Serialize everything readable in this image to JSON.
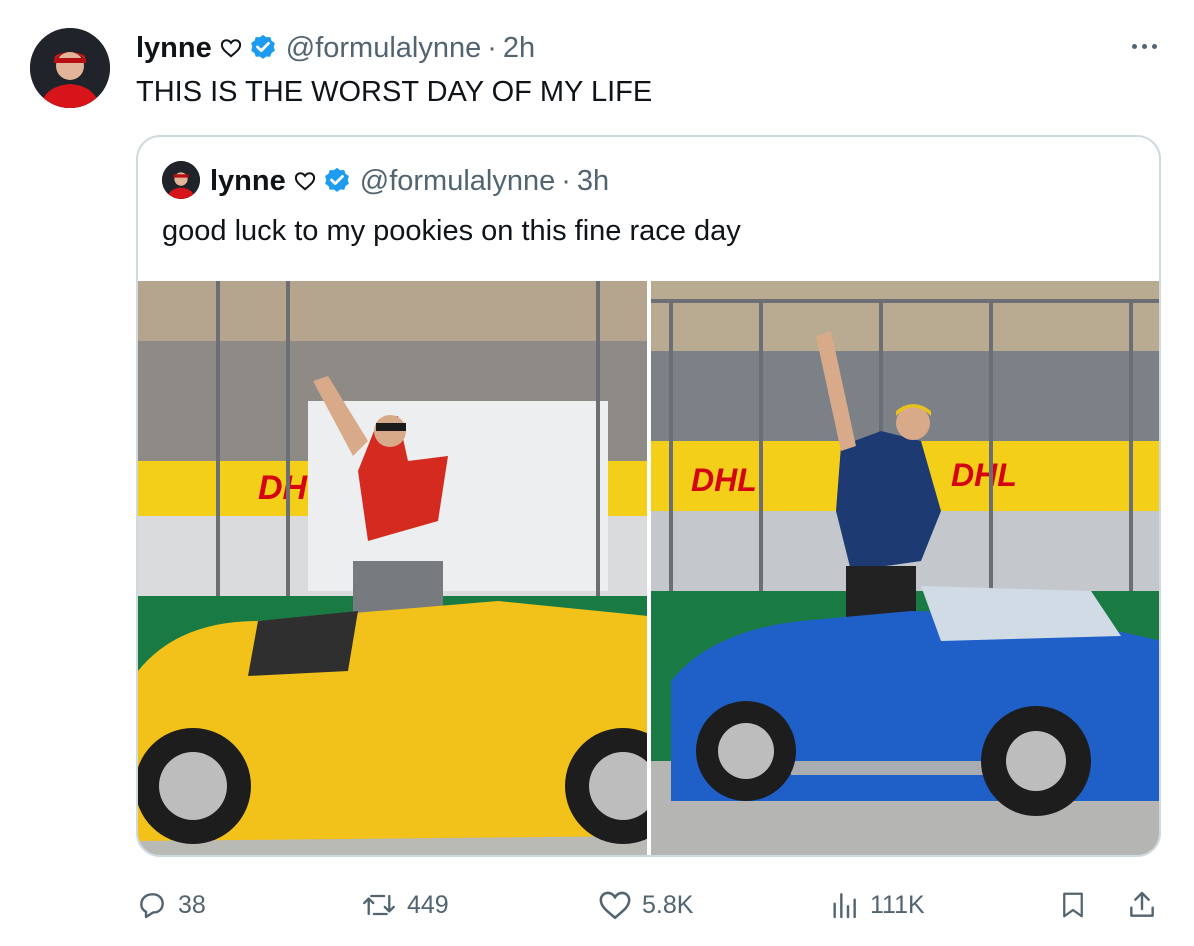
{
  "tweet": {
    "author_name": "lynne",
    "handle": "@formulalynne",
    "separator": "·",
    "time": "2h",
    "text": "THIS IS THE WORST DAY OF MY LIFE"
  },
  "quoted": {
    "author_name": "lynne",
    "handle": "@formulalynne",
    "separator": "·",
    "time": "3h",
    "text": "good luck to my pookies on this fine race day"
  },
  "actions": {
    "replies": "38",
    "reposts": "449",
    "likes": "5.8K",
    "views": "111K"
  },
  "colors": {
    "verified": "#1d9bf0",
    "muted_text": "#536471",
    "border": "#cfd9de",
    "yellow_car": "#f2c21a",
    "blue_car": "#1f5fc8"
  }
}
